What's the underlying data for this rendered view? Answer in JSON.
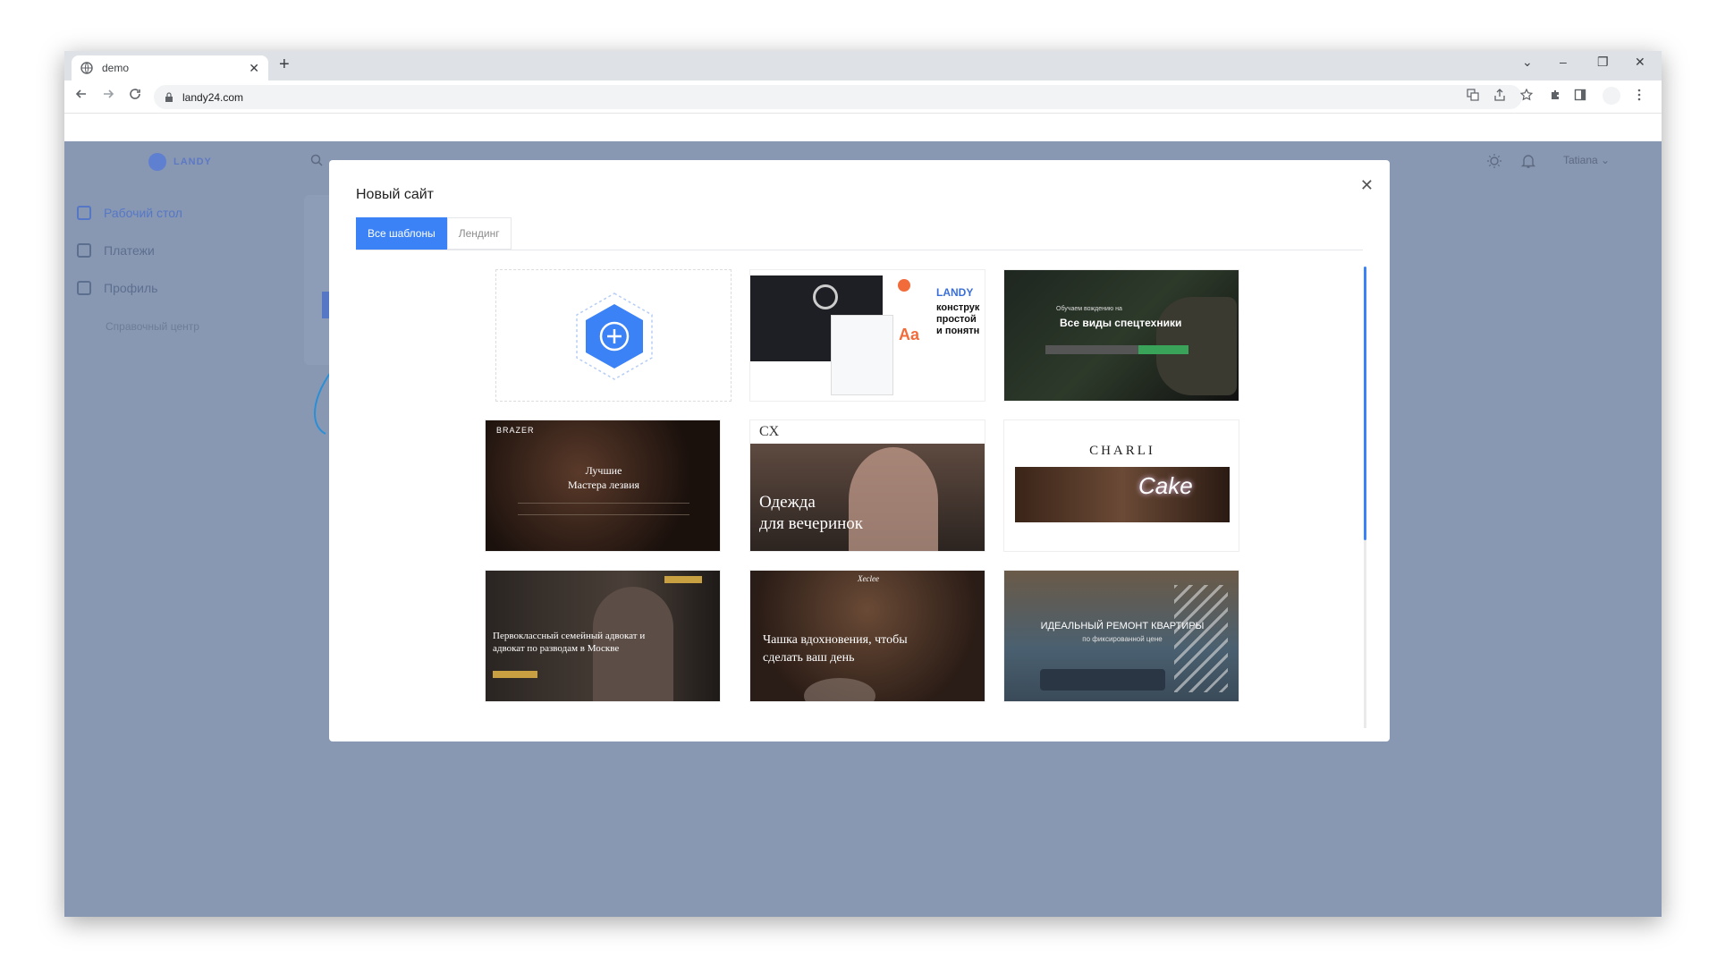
{
  "browser": {
    "tab_title": "demo",
    "tab_close": "✕",
    "new_tab": "+",
    "url": "landy24.com",
    "controls": {
      "dropdown": "⌄",
      "minimize": "–",
      "restore": "❐",
      "close": "✕"
    }
  },
  "app": {
    "logo": "LANDY",
    "user": "Tatiana ⌄",
    "sidebar": [
      {
        "label": "Рабочий стол",
        "icon": "grid-icon"
      },
      {
        "label": "Платежи",
        "icon": "bag-icon"
      },
      {
        "label": "Профиль",
        "icon": "sliders-icon"
      }
    ],
    "help_center": "Справочный центр"
  },
  "modal": {
    "title": "Новый сайт",
    "close": "✕",
    "tabs": [
      {
        "label": "Все шаблоны",
        "active": true
      },
      {
        "label": "Лендинг",
        "active": false
      }
    ],
    "templates": {
      "landy_brand": "LANDY",
      "landy_heading": "конструк\nпростой\nи понятн",
      "machinery_kicker": "Обучаем вождению на",
      "machinery_title": "Все виды спецтехники",
      "brazer_logo": "BRAZER",
      "brazer_title": "Лучшие\nМастера лезвия",
      "cx_logo": "CX",
      "cx_title": "Одежда\nдля вечеринок",
      "charli_logo": "CHARLI",
      "charli_sign": "Cake",
      "lawyer_title": "Первоклассный семейный адвокат и\nадвокат по разводам в Москве",
      "coffee_logo": "Xeclee",
      "coffee_title": "Чашка вдохновения, чтобы\nсделать ваш день",
      "renovation_title": "ИДЕАЛЬНЫЙ РЕМОНТ КВАРТИРЫ",
      "renovation_subtitle": "по фиксированной цене"
    }
  },
  "colors": {
    "accent": "#3b82f6",
    "overlay": "#8898b3",
    "landy_orange": "#f26b3a"
  }
}
